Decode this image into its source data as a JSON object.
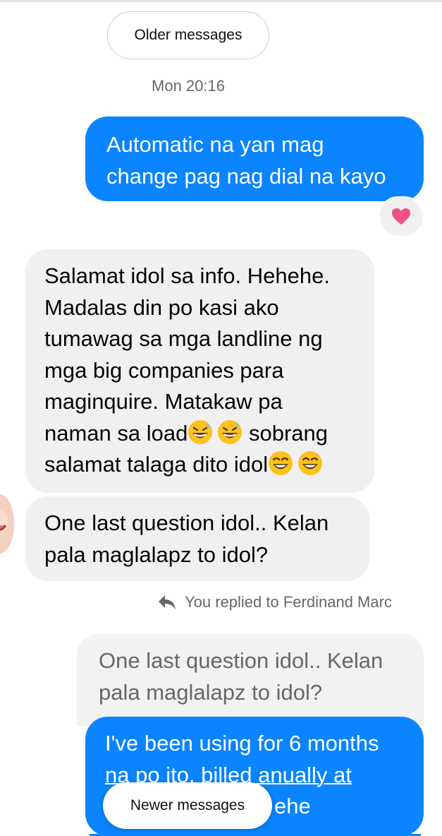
{
  "thread": {
    "older_label": "Older messages",
    "newer_label": "Newer messages",
    "timestamp": "Mon 20:16",
    "reply_note": "You replied to Ferdinand Marc"
  },
  "messages": {
    "m1": {
      "line1": "Automatic na yan mag",
      "line2": "change pag nag dial na kayo",
      "reaction": "heart"
    },
    "m2": {
      "line1": "Salamat idol sa info. Hehehe.",
      "line2": "Madalas din po kasi ako",
      "line3": "tumawag sa mga landline ng",
      "line4": "mga big companies para",
      "line5": "maginquire. Matakaw pa",
      "line6a": "naman sa load",
      "line6b": " sobrang",
      "line7": "salamat talaga dito idol"
    },
    "m3": {
      "line1": "One last question idol.. Kelan",
      "line2": "pala maglalapz to idol?"
    },
    "quoted": {
      "line1": "One last question idol.. Kelan",
      "line2": "pala maglalapz to idol?"
    },
    "m5": {
      "line1": "I've been using for 6 months",
      "line2": "na po ito, billed anually at",
      "line3_tail": "ehe"
    }
  },
  "icons": {
    "reaction": "heart-icon",
    "reply": "reply-arrow-icon",
    "emoji_sweat": "grinning-sweat-emoji",
    "emoji_grin": "grinning-squinting-emoji"
  },
  "colors": {
    "outgoing": "#0a84ff",
    "incoming": "#f0f0f0",
    "heart": "#f0508a",
    "secondary_text": "#65676b"
  }
}
